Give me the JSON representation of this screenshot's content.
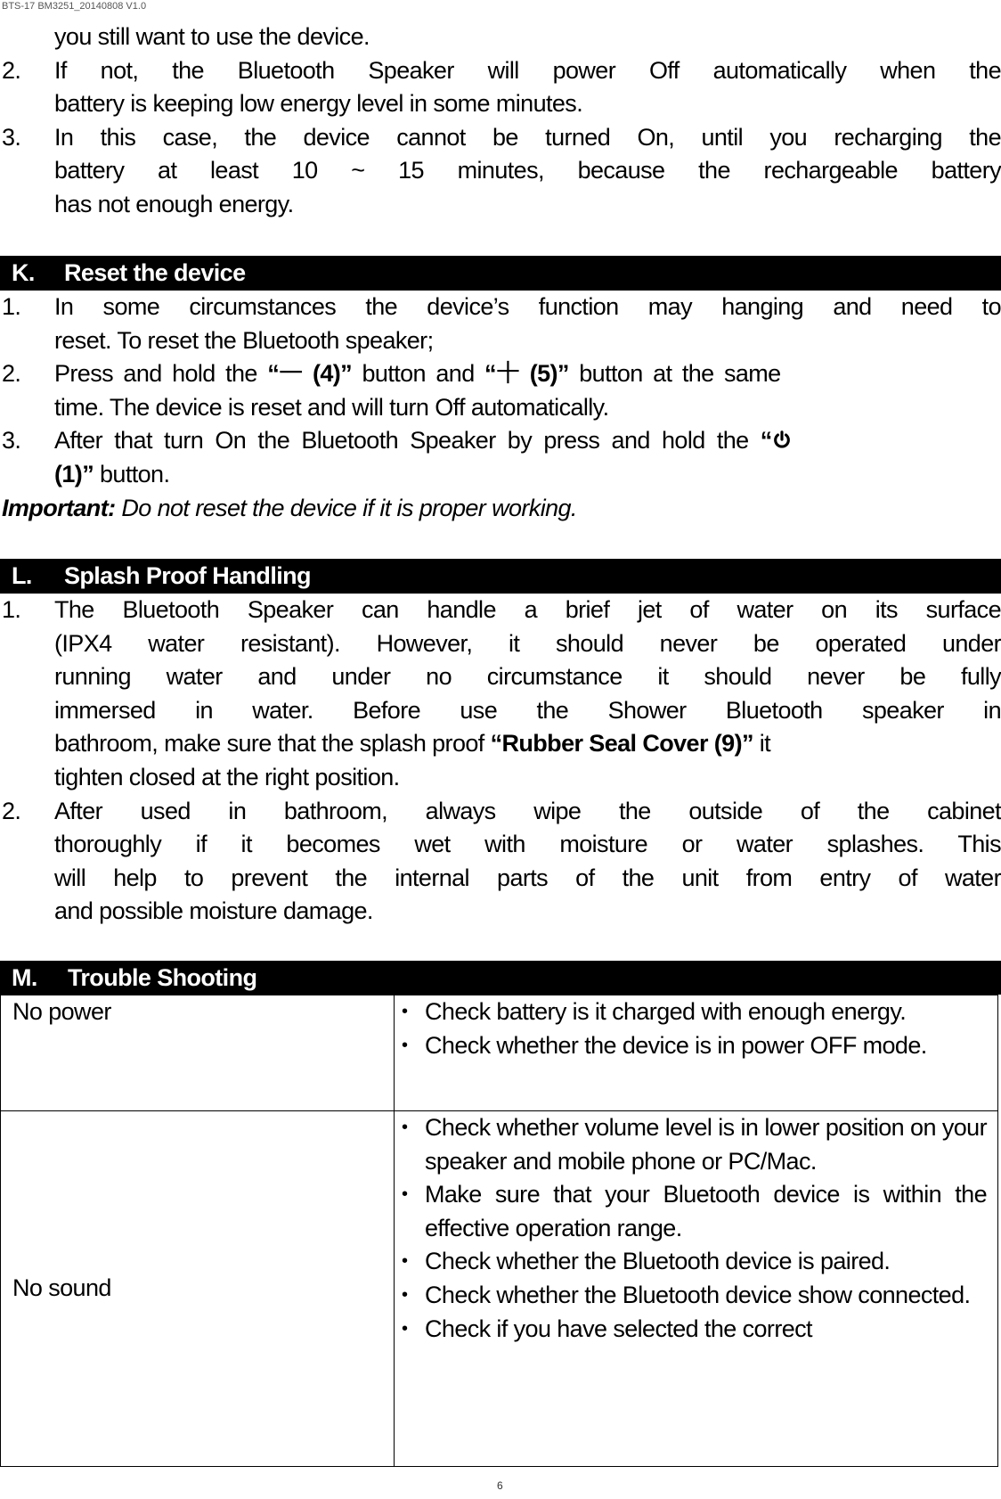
{
  "doc_id": "BTS-17 BM3251_20140808 V1.0",
  "intro": {
    "lines": [
      {
        "num": "",
        "text": "you still want to use the device.",
        "justify": false
      },
      {
        "num": "2.",
        "text": "If not, the Bluetooth Speaker will power Off automatically when the",
        "justify": true
      },
      {
        "num": "",
        "text": "battery is keeping low energy level in some minutes.",
        "justify": false
      },
      {
        "num": "3.",
        "text": "In this case, the device cannot be turned On, until you recharging the",
        "justify": true
      },
      {
        "num": "",
        "text": "battery at least 10 ~ 15 minutes, because the rechargeable battery",
        "justify": true
      },
      {
        "num": "",
        "text": "has not enough energy.",
        "justify": false
      }
    ]
  },
  "section_k": {
    "letter": "K.",
    "title": "Reset the device",
    "item1_num": "1.",
    "item1_line1": "In some circumstances the device’s function may hanging and need to",
    "item1_line2": "reset. To reset the Bluetooth speaker;",
    "item2_num": "2.",
    "item2_pre": "Press and hold the ",
    "item2_minus_open": "“",
    "item2_minus_glyph": "一",
    "item2_minus_label": " (4)”",
    "item2_mid": " button and ",
    "item2_plus_open": "“",
    "item2_plus_glyph": "十",
    "item2_plus_label": " (5)”",
    "item2_post": " button at the same",
    "item2_line2": "time. The device is reset and will turn Off automatically.",
    "item3_num": "3.",
    "item3_line1": "After that turn On the Bluetooth Speaker by press and hold the",
    "item3_open_quote": "“",
    "item3_icon": "power-icon",
    "item3_label": "(1)”",
    "item3_post": " button.",
    "important_label": "Important:",
    "important_text": " Do not reset the device if it is proper working."
  },
  "section_l": {
    "letter": "L.",
    "title": "Splash Proof Handling",
    "item1_num": "1.",
    "item1_lines": [
      "The Bluetooth Speaker can handle a brief jet of water on its surface",
      "(IPX4 water resistant). However, it should never be operated under",
      "running water and under no circumstance it should never be fully",
      "immersed in water. Before use the Shower Bluetooth speaker in"
    ],
    "item1_line5_pre": "bathroom, make sure that the splash proof ",
    "item1_line5_bold": "“Rubber Seal Cover (9)”",
    "item1_line5_post": " it",
    "item1_line6": "tighten closed at the right position.",
    "item2_num": "2.",
    "item2_lines": [
      "After used in bathroom, always wipe the outside of the cabinet",
      "thoroughly if it becomes wet with moisture or water splashes. This",
      "will help to prevent the internal parts of the unit from entry of water"
    ],
    "item2_last": "and possible moisture damage."
  },
  "section_m": {
    "letter": "M.",
    "title": "Trouble Shooting",
    "bullet": "•",
    "rows": [
      {
        "problem": "No power",
        "fixes": [
          "Check battery is it charged with enough energy.",
          "Check whether the device is in power OFF mode."
        ]
      },
      {
        "problem": "No sound",
        "fixes": [
          "Check whether volume level is in lower position on your speaker and mobile phone or PC/Mac.",
          "Make sure that your Bluetooth device is within the effective operation range.",
          "Check whether the Bluetooth device is paired.",
          "Check whether the Bluetooth device show connected.",
          "Check if you have selected the correct"
        ]
      }
    ]
  },
  "page_number": "6"
}
